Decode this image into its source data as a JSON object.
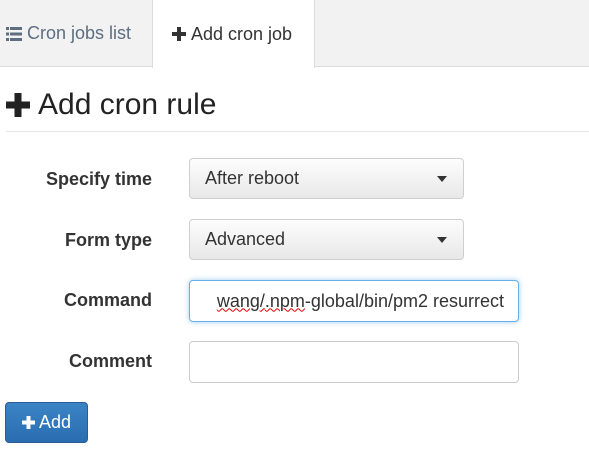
{
  "tabs": [
    {
      "label": "Cron jobs list",
      "icon": "list-icon",
      "active": false
    },
    {
      "label": "Add cron job",
      "icon": "plus-icon",
      "active": true
    }
  ],
  "page": {
    "title": "Add cron rule",
    "title_icon": "plus-icon"
  },
  "form": {
    "specify_time": {
      "label": "Specify time",
      "value": "After reboot"
    },
    "form_type": {
      "label": "Form type",
      "value": "Advanced"
    },
    "command": {
      "label": "Command",
      "value_misspelled": "wang/",
      "value_misspelled_2": ".npm",
      "value_rest": "-global/bin/pm2 resurrect"
    },
    "comment": {
      "label": "Comment",
      "value": ""
    }
  },
  "actions": {
    "add_label": "Add",
    "add_icon": "plus-icon"
  },
  "colors": {
    "primary_button": "#2f77bb",
    "focus_ring": "#66afe9",
    "tabbar_bg": "#f2f2f2"
  }
}
